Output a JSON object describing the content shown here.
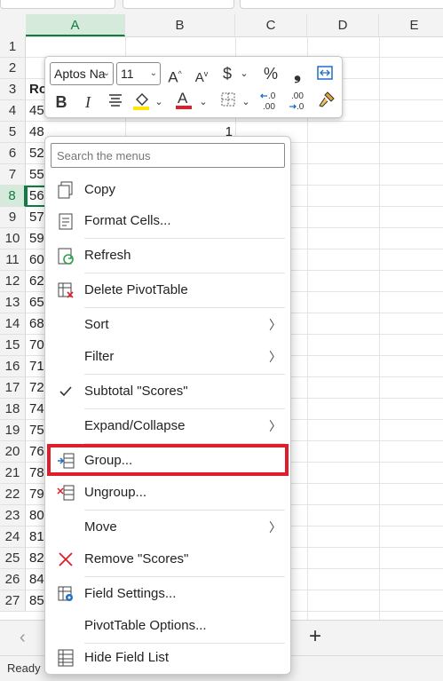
{
  "columns": [
    "A",
    "B",
    "C",
    "D",
    "E"
  ],
  "rows": [
    "1",
    "2",
    "3",
    "4",
    "5",
    "6",
    "7",
    "8",
    "9",
    "10",
    "11",
    "12",
    "13",
    "14",
    "15",
    "16",
    "17",
    "18",
    "19",
    "20",
    "21",
    "22",
    "23",
    "24",
    "25",
    "26",
    "27"
  ],
  "column_a": [
    "",
    "",
    "Ro",
    "45",
    "48",
    "52",
    "55",
    "56",
    "57",
    "59",
    "60",
    "62",
    "65",
    "68",
    "70",
    "71",
    "72",
    "74",
    "75",
    "76",
    "78",
    "79",
    "80",
    "81",
    "82",
    "84",
    "85"
  ],
  "cell_b5": "1",
  "mini_toolbar": {
    "font_name": "Aptos Na",
    "font_size": "11",
    "bold": "B",
    "italic": "I",
    "currency": "$",
    "percent": "%",
    "comma": "❟",
    "highlight_color": "#ffe600",
    "font_color": "#e01e2b"
  },
  "context_menu": {
    "search_placeholder": "Search the menus",
    "copy": "Copy",
    "format_cells": "Format Cells...",
    "refresh": "Refresh",
    "delete_pivottable": "Delete PivotTable",
    "sort": "Sort",
    "filter": "Filter",
    "subtotal": "Subtotal \"Scores\"",
    "expand_collapse": "Expand/Collapse",
    "group": "Group...",
    "ungroup": "Ungroup...",
    "move": "Move",
    "remove": "Remove \"Scores\"",
    "field_settings": "Field Settings...",
    "pivottable_options": "PivotTable Options...",
    "hide_field_list": "Hide Field List"
  },
  "sheet_bar": {
    "prev": "‹",
    "add": "+"
  },
  "status": "Ready"
}
